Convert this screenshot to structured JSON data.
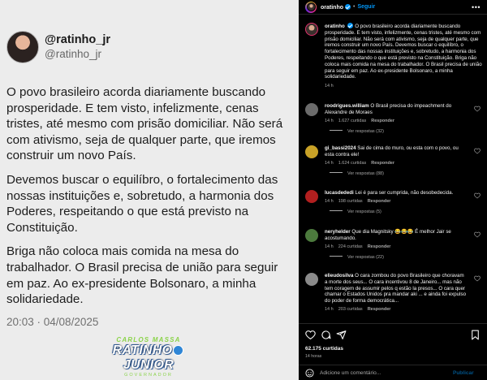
{
  "post": {
    "tweet_name": "@ratinho_jr",
    "tweet_handle": "@ratinho_jr",
    "paragraphs": [
      "O povo brasileiro acorda diariamente buscando prosperidade. E tem visto, infelizmente, cenas tristes, até mesmo com prisão domiciliar. Não será com ativismo, seja de qualquer parte, que iremos construir um novo País.",
      "Devemos buscar o equilíbro, o fortalecimento das nossas instituições e, sobretudo, a harmonia dos Poderes,  respeitando o que está previsto na Constituição.",
      "Briga não coloca mais comida na mesa do trabalhador. O Brasil precisa de união para seguir em paz. Ao ex-presidente Bolsonaro, a minha solidariedade."
    ],
    "tweet_date": "20:03 · 04/08/2025",
    "brand_top": "CARLOS MASSA",
    "brand_main_left": "RATINHO",
    "brand_main_right": "JUNIOR",
    "brand_sub": "GOVERNADOR"
  },
  "header": {
    "username": "oratinho",
    "separator": "•",
    "follow_label": "Seguir",
    "more_icon": "more-horizontal-icon"
  },
  "caption": {
    "username": "oratinho",
    "text": "O povo brasileiro acorda diariamente buscando prosperidade. E tem visto, infelizmente, cenas tristes, até mesmo com prisão domiciliar. Não será com ativismo, seja de qualquer parte, que iremos construir um novo País. Devemos buscar o equilíbro, o fortalecimento das nossas instituições e, sobretudo, a harmonia dos Poderes, respeitando o que está previsto na Constituição. Briga não coloca mais comida na mesa do trabalhador. O Brasil precisa de união para seguir em paz. Ao ex-presidente Bolsonaro, a minha solidariedade.",
    "time": "14 h"
  },
  "comments": [
    {
      "username": "roodrigues.william",
      "text": "O Brasil precisa do impeachment do Alexandre de Moraes",
      "time": "14 h",
      "likes": "1.627 curtidas",
      "reply": "Responder",
      "replies": "Ver respostas (32)",
      "avatar_color": "#6b6b6b"
    },
    {
      "username": "gi_bassi2024",
      "text": "Sai de cima do muro, ou esta com o povo, ou esta contra ele!",
      "time": "14 h",
      "likes": "1.624 curtidas",
      "reply": "Responder",
      "replies": "Ver respostas (88)",
      "avatar_color": "#c9a227"
    },
    {
      "username": "lucasdededi",
      "text": "Lei é para ser cumprida, não desobedecida.",
      "time": "14 h",
      "likes": "198 curtidas",
      "reply": "Responder",
      "replies": "Ver respostas (5)",
      "avatar_color": "#b21f1f"
    },
    {
      "username": "neryhelder",
      "text": "Que dia Magnitsky 😂😂😂 É melhor Jair se acostumando.",
      "time": "14 h",
      "likes": "224 curtidas",
      "reply": "Responder",
      "replies": "Ver respostas (22)",
      "avatar_color": "#4c7a3d"
    },
    {
      "username": "elieudosilva",
      "text": "O cara zombou do povo Brasileiro que choravam a morte dos seus... O cara incentivou 8 de Janeiro... mas não tem coragem de assumir pelos q estão la presos... O cara quer chamar o Estados Unidos pra mandar aki ... e ainda foi expulso do poder de forma democrática...",
      "time": "14 h",
      "likes": "203 curtidas",
      "reply": "Responder",
      "replies": "",
      "avatar_color": "#8a8a8a"
    }
  ],
  "actions": {
    "likes": "62.175 curtidas",
    "ago": "14 horas",
    "comment_placeholder": "Adicione um comentário...",
    "publish_label": "Publicar"
  }
}
